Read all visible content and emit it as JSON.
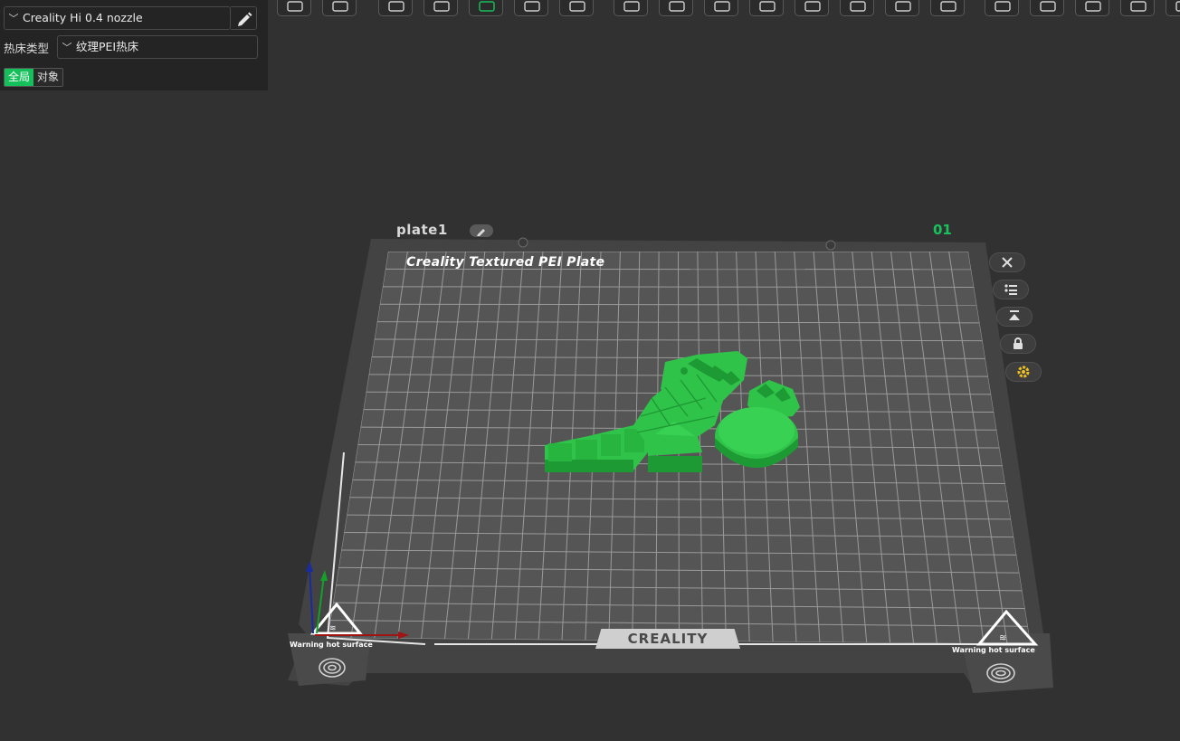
{
  "printer": {
    "selected": "Creality Hi 0.4 nozzle"
  },
  "bed": {
    "label": "热床类型",
    "selected": "纹理PEI热床"
  },
  "scope_tabs": {
    "global": "全局",
    "object": "对象"
  },
  "plate": {
    "label": "plate1",
    "index": "01",
    "name": "Creality Textured PEI Plate",
    "brand": "CREALITY",
    "warning_left": "Warning hot surface",
    "warning_right": "Warning hot surface"
  },
  "colors": {
    "accent": "#19c15c",
    "model": "#2fc449",
    "model_shade": "#1e9a35",
    "warning_icon": "#f0c020"
  },
  "toolbar": {
    "icons": [
      "cube-view-icon",
      "grid-view-icon",
      "add-object-icon",
      "delete-object-icon",
      "auto-arrange-icon",
      "orient-icon",
      "lay-on-face-icon",
      "split-objects-icon",
      "support-icon",
      "scale-icon",
      "measure-icon",
      "cut-icon",
      "seam-paint-icon",
      "mesh-boolean-icon",
      "text-emboss-icon",
      "svg-icon",
      "assembly-icon",
      "slice-view-icon",
      "layers-icon",
      "more-icon"
    ]
  },
  "side_tools": [
    "close-icon",
    "list-icon",
    "auto-orient-icon",
    "lock-icon",
    "settings-icon"
  ]
}
